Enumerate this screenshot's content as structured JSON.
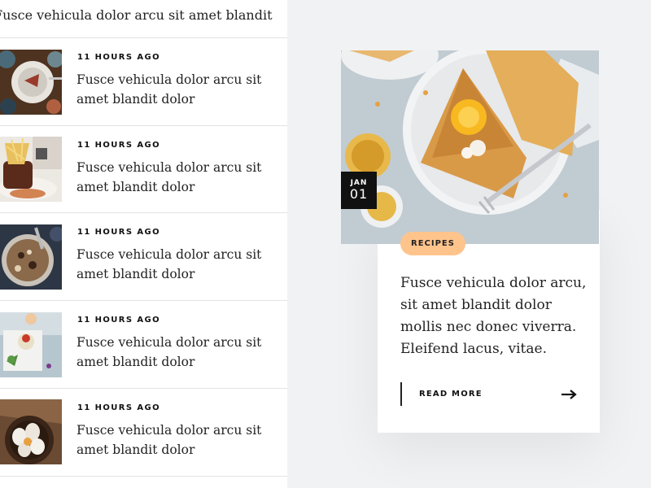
{
  "feed": {
    "top_item_title": "Fusce vehicula dolor arcu sit amet blandit",
    "items": [
      {
        "time": "11 HOURS AGO",
        "title": "Fusce vehicula dolor arcu sit amet blandit dolor",
        "image": "dinner-table-photo"
      },
      {
        "time": "11 HOURS AGO",
        "title": "Fusce vehicula dolor arcu sit amet blandit dolor",
        "image": "dessert-plate-photo"
      },
      {
        "time": "11 HOURS AGO",
        "title": "Fusce vehicula dolor arcu sit amet blandit dolor",
        "image": "granola-bowl-photo"
      },
      {
        "time": "11 HOURS AGO",
        "title": "Fusce vehicula dolor arcu sit amet blandit dolor",
        "image": "appetizer-plate-photo"
      },
      {
        "time": "11 HOURS AGO",
        "title": "Fusce vehicula dolor arcu sit amet blandit dolor",
        "image": "eggs-bowl-photo"
      }
    ]
  },
  "card": {
    "image": "crepes-plate-photo",
    "date": {
      "month": "JAN",
      "day": "01"
    },
    "tag": "RECIPES",
    "text": "Fusce vehicula dolor arcu, sit amet blandit dolor mollis nec donec viverra. Eleifend lacus, vitae.",
    "read_more": "READ MORE",
    "arrow_icon": "arrow-right-icon"
  },
  "colors": {
    "background": "#f1f2f4",
    "tag": "#ffc48c",
    "badge": "#111111"
  }
}
